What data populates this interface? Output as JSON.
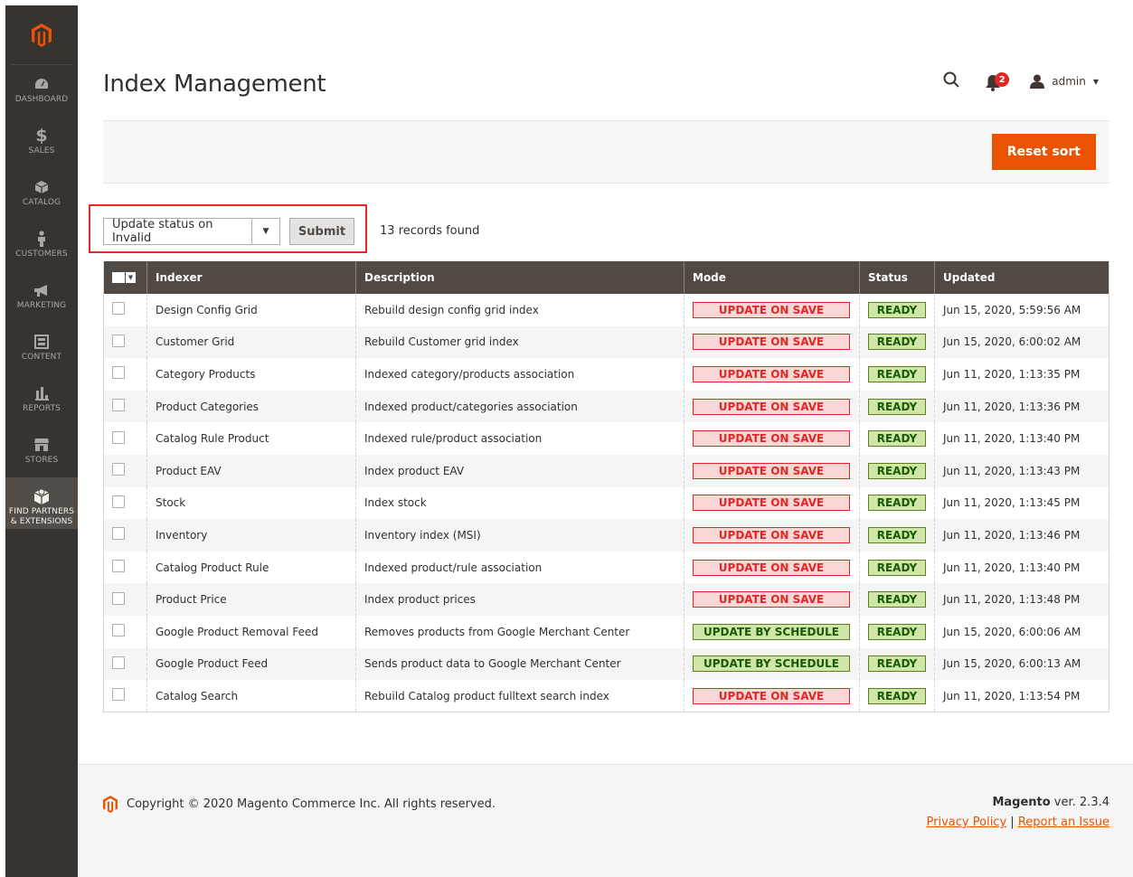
{
  "app": {
    "title": "Index Management",
    "user": "admin",
    "notification_count": "2",
    "brand_color": "#eb5202"
  },
  "sidebar": {
    "items": [
      {
        "label": "DASHBOARD",
        "icon": "dashboard-icon"
      },
      {
        "label": "SALES",
        "icon": "dollar-icon"
      },
      {
        "label": "CATALOG",
        "icon": "cube-icon"
      },
      {
        "label": "CUSTOMERS",
        "icon": "person-icon"
      },
      {
        "label": "MARKETING",
        "icon": "megaphone-icon"
      },
      {
        "label": "CONTENT",
        "icon": "layout-icon"
      },
      {
        "label": "REPORTS",
        "icon": "bar-chart-icon"
      },
      {
        "label": "STORES",
        "icon": "store-icon"
      },
      {
        "label": "FIND PARTNERS & EXTENSIONS",
        "icon": "extensions-icon"
      }
    ]
  },
  "actions": {
    "reset_sort": "Reset sort",
    "massaction_value": "Update status on Invalid",
    "submit": "Submit",
    "records_found": "13 records found"
  },
  "grid": {
    "headers": {
      "indexer": "Indexer",
      "description": "Description",
      "mode": "Mode",
      "status": "Status",
      "updated": "Updated"
    },
    "rows": [
      {
        "indexer": "Design Config Grid",
        "description": "Rebuild design config grid index",
        "mode": "UPDATE ON SAVE",
        "status": "READY",
        "updated": "Jun 15, 2020, 5:59:56 AM"
      },
      {
        "indexer": "Customer Grid",
        "description": "Rebuild Customer grid index",
        "mode": "UPDATE ON SAVE",
        "status": "READY",
        "updated": "Jun 15, 2020, 6:00:02 AM"
      },
      {
        "indexer": "Category Products",
        "description": "Indexed category/products association",
        "mode": "UPDATE ON SAVE",
        "status": "READY",
        "updated": "Jun 11, 2020, 1:13:35 PM"
      },
      {
        "indexer": "Product Categories",
        "description": "Indexed product/categories association",
        "mode": "UPDATE ON SAVE",
        "status": "READY",
        "updated": "Jun 11, 2020, 1:13:36 PM"
      },
      {
        "indexer": "Catalog Rule Product",
        "description": "Indexed rule/product association",
        "mode": "UPDATE ON SAVE",
        "status": "READY",
        "updated": "Jun 11, 2020, 1:13:40 PM"
      },
      {
        "indexer": "Product EAV",
        "description": "Index product EAV",
        "mode": "UPDATE ON SAVE",
        "status": "READY",
        "updated": "Jun 11, 2020, 1:13:43 PM"
      },
      {
        "indexer": "Stock",
        "description": "Index stock",
        "mode": "UPDATE ON SAVE",
        "status": "READY",
        "updated": "Jun 11, 2020, 1:13:45 PM"
      },
      {
        "indexer": "Inventory",
        "description": "Inventory index (MSI)",
        "mode": "UPDATE ON SAVE",
        "status": "READY",
        "updated": "Jun 11, 2020, 1:13:46 PM"
      },
      {
        "indexer": "Catalog Product Rule",
        "description": "Indexed product/rule association",
        "mode": "UPDATE ON SAVE",
        "status": "READY",
        "updated": "Jun 11, 2020, 1:13:40 PM"
      },
      {
        "indexer": "Product Price",
        "description": "Index product prices",
        "mode": "UPDATE ON SAVE",
        "status": "READY",
        "updated": "Jun 11, 2020, 1:13:48 PM"
      },
      {
        "indexer": "Google Product Removal Feed",
        "description": "Removes products from Google Merchant Center",
        "mode": "UPDATE BY SCHEDULE",
        "status": "READY",
        "updated": "Jun 15, 2020, 6:00:06 AM"
      },
      {
        "indexer": "Google Product Feed",
        "description": "Sends product data to Google Merchant Center",
        "mode": "UPDATE BY SCHEDULE",
        "status": "READY",
        "updated": "Jun 15, 2020, 6:00:13 AM"
      },
      {
        "indexer": "Catalog Search",
        "description": "Rebuild Catalog product fulltext search index",
        "mode": "UPDATE ON SAVE",
        "status": "READY",
        "updated": "Jun 11, 2020, 1:13:54 PM"
      }
    ]
  },
  "footer": {
    "copyright": "Copyright © 2020 Magento Commerce Inc. All rights reserved.",
    "brand": "Magento",
    "version": " ver. 2.3.4",
    "privacy": "Privacy Policy",
    "separator": " | ",
    "report": "Report an Issue"
  }
}
